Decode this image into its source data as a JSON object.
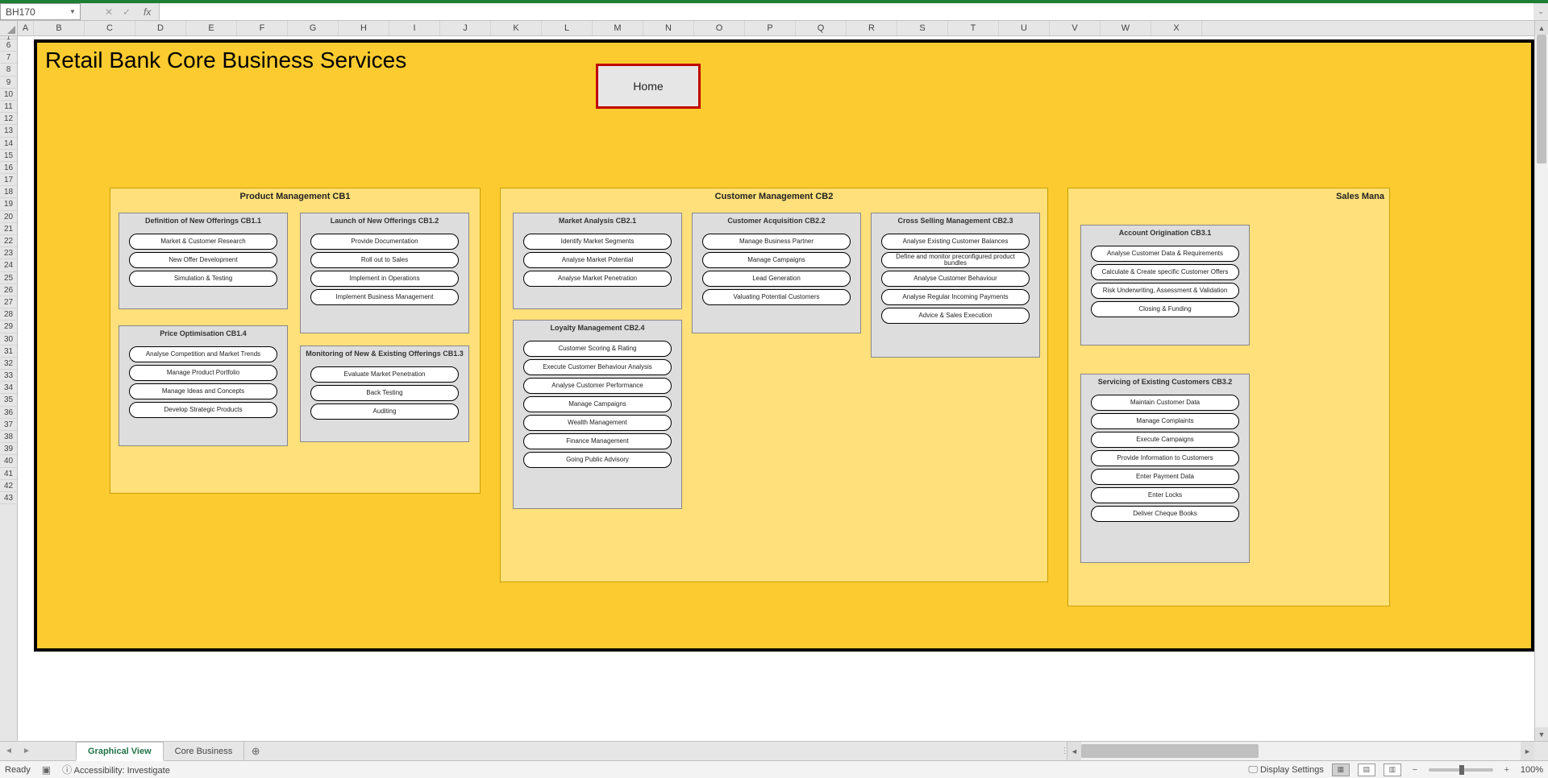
{
  "nameBox": "BH170",
  "formula": "",
  "fxLabel": "fx",
  "columns": [
    "A",
    "B",
    "C",
    "D",
    "E",
    "F",
    "G",
    "H",
    "I",
    "J",
    "K",
    "L",
    "M",
    "N",
    "O",
    "P",
    "Q",
    "R",
    "S",
    "T",
    "U",
    "V",
    "W",
    "X"
  ],
  "rows": [
    "1",
    "6",
    "7",
    "8",
    "9",
    "10",
    "11",
    "12",
    "13",
    "14",
    "15",
    "16",
    "17",
    "18",
    "19",
    "20",
    "21",
    "22",
    "23",
    "24",
    "25",
    "26",
    "27",
    "28",
    "29",
    "30",
    "31",
    "32",
    "33",
    "34",
    "35",
    "36",
    "37",
    "38",
    "39",
    "40",
    "41",
    "42",
    "43"
  ],
  "sheetTitle": "Retail Bank Core Business Services",
  "homeButton": "Home",
  "cat1": {
    "title": "Product Management CB1",
    "g1": {
      "title": "Definition of New Offerings CB1.1",
      "items": [
        "Market & Customer Research",
        "New Offer Development",
        "Simulation & Testing"
      ]
    },
    "g2": {
      "title": "Launch of New Offerings CB1.2",
      "items": [
        "Provide Documentation",
        "Roll out to Sales",
        "Implement in Operations",
        "Implement Business Management"
      ]
    },
    "g3": {
      "title": "Price Optimisation CB1.4",
      "items": [
        "Analyse Competition and Market Trends",
        "Manage Product Portfolio",
        "Manage Ideas and Concepts",
        "Develop Strategic Products"
      ]
    },
    "g4": {
      "title": "Monitoring of New & Existing Offerings CB1.3",
      "items": [
        "Evaluate Market Penetration",
        "Back Testing",
        "Auditing"
      ]
    }
  },
  "cat2": {
    "title": "Customer Management CB2",
    "g1": {
      "title": "Market Analysis CB2.1",
      "items": [
        "Identify Market Segments",
        "Analyse Market Potential",
        "Analyse Market Penetration"
      ]
    },
    "g2": {
      "title": "Customer Acquisition CB2.2",
      "items": [
        "Manage Business Partner",
        "Manage Campaigns",
        "Lead Generation",
        "Valuating Potential Customers"
      ]
    },
    "g3": {
      "title": "Cross Selling Management CB2.3",
      "items": [
        "Analyse Existing Customer Balances",
        "Define and monitor preconfigured product bundles",
        "Analyse Customer Behaviour",
        "Analyse Regular Incoming Payments",
        "Advice & Sales Execution"
      ]
    },
    "g4": {
      "title": "Loyalty Management CB2.4",
      "items": [
        "Customer Scoring & Rating",
        "Execute Customer Behaviour Analysis",
        "Analyse Customer Performance",
        "Manage Campaigns",
        "Wealth Management",
        "Finance Management",
        "Going Public Advisory"
      ]
    }
  },
  "cat3": {
    "title": "Sales Mana",
    "g1": {
      "title": "Account Origination CB3.1",
      "items": [
        "Analyse Customer Data & Requirements",
        "Calculate & Create specific Customer Offers",
        "Risk Underwriting, Assessment & Validation",
        "Closing & Funding"
      ]
    },
    "g2": {
      "title": "Servicing of Existing Customers CB3.2",
      "items": [
        "Maintain Customer Data",
        "Manage Complaints",
        "Execute Campaigns",
        "Provide Information to Customers",
        "Enter Payment Data",
        "Enter Locks",
        "Deliver Cheque Books"
      ]
    }
  },
  "tabs": {
    "active": "Graphical View",
    "other": "Core Business"
  },
  "status": {
    "ready": "Ready",
    "accessibility": "Accessibility: Investigate",
    "displaySettings": "Display Settings",
    "zoom": "100%"
  }
}
